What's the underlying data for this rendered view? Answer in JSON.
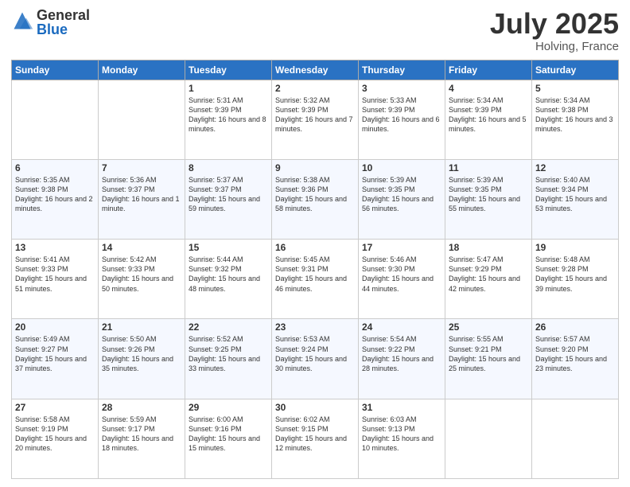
{
  "logo": {
    "general": "General",
    "blue": "Blue"
  },
  "title": {
    "month": "July 2025",
    "location": "Holving, France"
  },
  "calendar": {
    "headers": [
      "Sunday",
      "Monday",
      "Tuesday",
      "Wednesday",
      "Thursday",
      "Friday",
      "Saturday"
    ],
    "rows": [
      [
        {
          "day": "",
          "info": ""
        },
        {
          "day": "",
          "info": ""
        },
        {
          "day": "1",
          "info": "Sunrise: 5:31 AM\nSunset: 9:39 PM\nDaylight: 16 hours and 8 minutes."
        },
        {
          "day": "2",
          "info": "Sunrise: 5:32 AM\nSunset: 9:39 PM\nDaylight: 16 hours and 7 minutes."
        },
        {
          "day": "3",
          "info": "Sunrise: 5:33 AM\nSunset: 9:39 PM\nDaylight: 16 hours and 6 minutes."
        },
        {
          "day": "4",
          "info": "Sunrise: 5:34 AM\nSunset: 9:39 PM\nDaylight: 16 hours and 5 minutes."
        },
        {
          "day": "5",
          "info": "Sunrise: 5:34 AM\nSunset: 9:38 PM\nDaylight: 16 hours and 3 minutes."
        }
      ],
      [
        {
          "day": "6",
          "info": "Sunrise: 5:35 AM\nSunset: 9:38 PM\nDaylight: 16 hours and 2 minutes."
        },
        {
          "day": "7",
          "info": "Sunrise: 5:36 AM\nSunset: 9:37 PM\nDaylight: 16 hours and 1 minute."
        },
        {
          "day": "8",
          "info": "Sunrise: 5:37 AM\nSunset: 9:37 PM\nDaylight: 15 hours and 59 minutes."
        },
        {
          "day": "9",
          "info": "Sunrise: 5:38 AM\nSunset: 9:36 PM\nDaylight: 15 hours and 58 minutes."
        },
        {
          "day": "10",
          "info": "Sunrise: 5:39 AM\nSunset: 9:35 PM\nDaylight: 15 hours and 56 minutes."
        },
        {
          "day": "11",
          "info": "Sunrise: 5:39 AM\nSunset: 9:35 PM\nDaylight: 15 hours and 55 minutes."
        },
        {
          "day": "12",
          "info": "Sunrise: 5:40 AM\nSunset: 9:34 PM\nDaylight: 15 hours and 53 minutes."
        }
      ],
      [
        {
          "day": "13",
          "info": "Sunrise: 5:41 AM\nSunset: 9:33 PM\nDaylight: 15 hours and 51 minutes."
        },
        {
          "day": "14",
          "info": "Sunrise: 5:42 AM\nSunset: 9:33 PM\nDaylight: 15 hours and 50 minutes."
        },
        {
          "day": "15",
          "info": "Sunrise: 5:44 AM\nSunset: 9:32 PM\nDaylight: 15 hours and 48 minutes."
        },
        {
          "day": "16",
          "info": "Sunrise: 5:45 AM\nSunset: 9:31 PM\nDaylight: 15 hours and 46 minutes."
        },
        {
          "day": "17",
          "info": "Sunrise: 5:46 AM\nSunset: 9:30 PM\nDaylight: 15 hours and 44 minutes."
        },
        {
          "day": "18",
          "info": "Sunrise: 5:47 AM\nSunset: 9:29 PM\nDaylight: 15 hours and 42 minutes."
        },
        {
          "day": "19",
          "info": "Sunrise: 5:48 AM\nSunset: 9:28 PM\nDaylight: 15 hours and 39 minutes."
        }
      ],
      [
        {
          "day": "20",
          "info": "Sunrise: 5:49 AM\nSunset: 9:27 PM\nDaylight: 15 hours and 37 minutes."
        },
        {
          "day": "21",
          "info": "Sunrise: 5:50 AM\nSunset: 9:26 PM\nDaylight: 15 hours and 35 minutes."
        },
        {
          "day": "22",
          "info": "Sunrise: 5:52 AM\nSunset: 9:25 PM\nDaylight: 15 hours and 33 minutes."
        },
        {
          "day": "23",
          "info": "Sunrise: 5:53 AM\nSunset: 9:24 PM\nDaylight: 15 hours and 30 minutes."
        },
        {
          "day": "24",
          "info": "Sunrise: 5:54 AM\nSunset: 9:22 PM\nDaylight: 15 hours and 28 minutes."
        },
        {
          "day": "25",
          "info": "Sunrise: 5:55 AM\nSunset: 9:21 PM\nDaylight: 15 hours and 25 minutes."
        },
        {
          "day": "26",
          "info": "Sunrise: 5:57 AM\nSunset: 9:20 PM\nDaylight: 15 hours and 23 minutes."
        }
      ],
      [
        {
          "day": "27",
          "info": "Sunrise: 5:58 AM\nSunset: 9:19 PM\nDaylight: 15 hours and 20 minutes."
        },
        {
          "day": "28",
          "info": "Sunrise: 5:59 AM\nSunset: 9:17 PM\nDaylight: 15 hours and 18 minutes."
        },
        {
          "day": "29",
          "info": "Sunrise: 6:00 AM\nSunset: 9:16 PM\nDaylight: 15 hours and 15 minutes."
        },
        {
          "day": "30",
          "info": "Sunrise: 6:02 AM\nSunset: 9:15 PM\nDaylight: 15 hours and 12 minutes."
        },
        {
          "day": "31",
          "info": "Sunrise: 6:03 AM\nSunset: 9:13 PM\nDaylight: 15 hours and 10 minutes."
        },
        {
          "day": "",
          "info": ""
        },
        {
          "day": "",
          "info": ""
        }
      ]
    ]
  }
}
